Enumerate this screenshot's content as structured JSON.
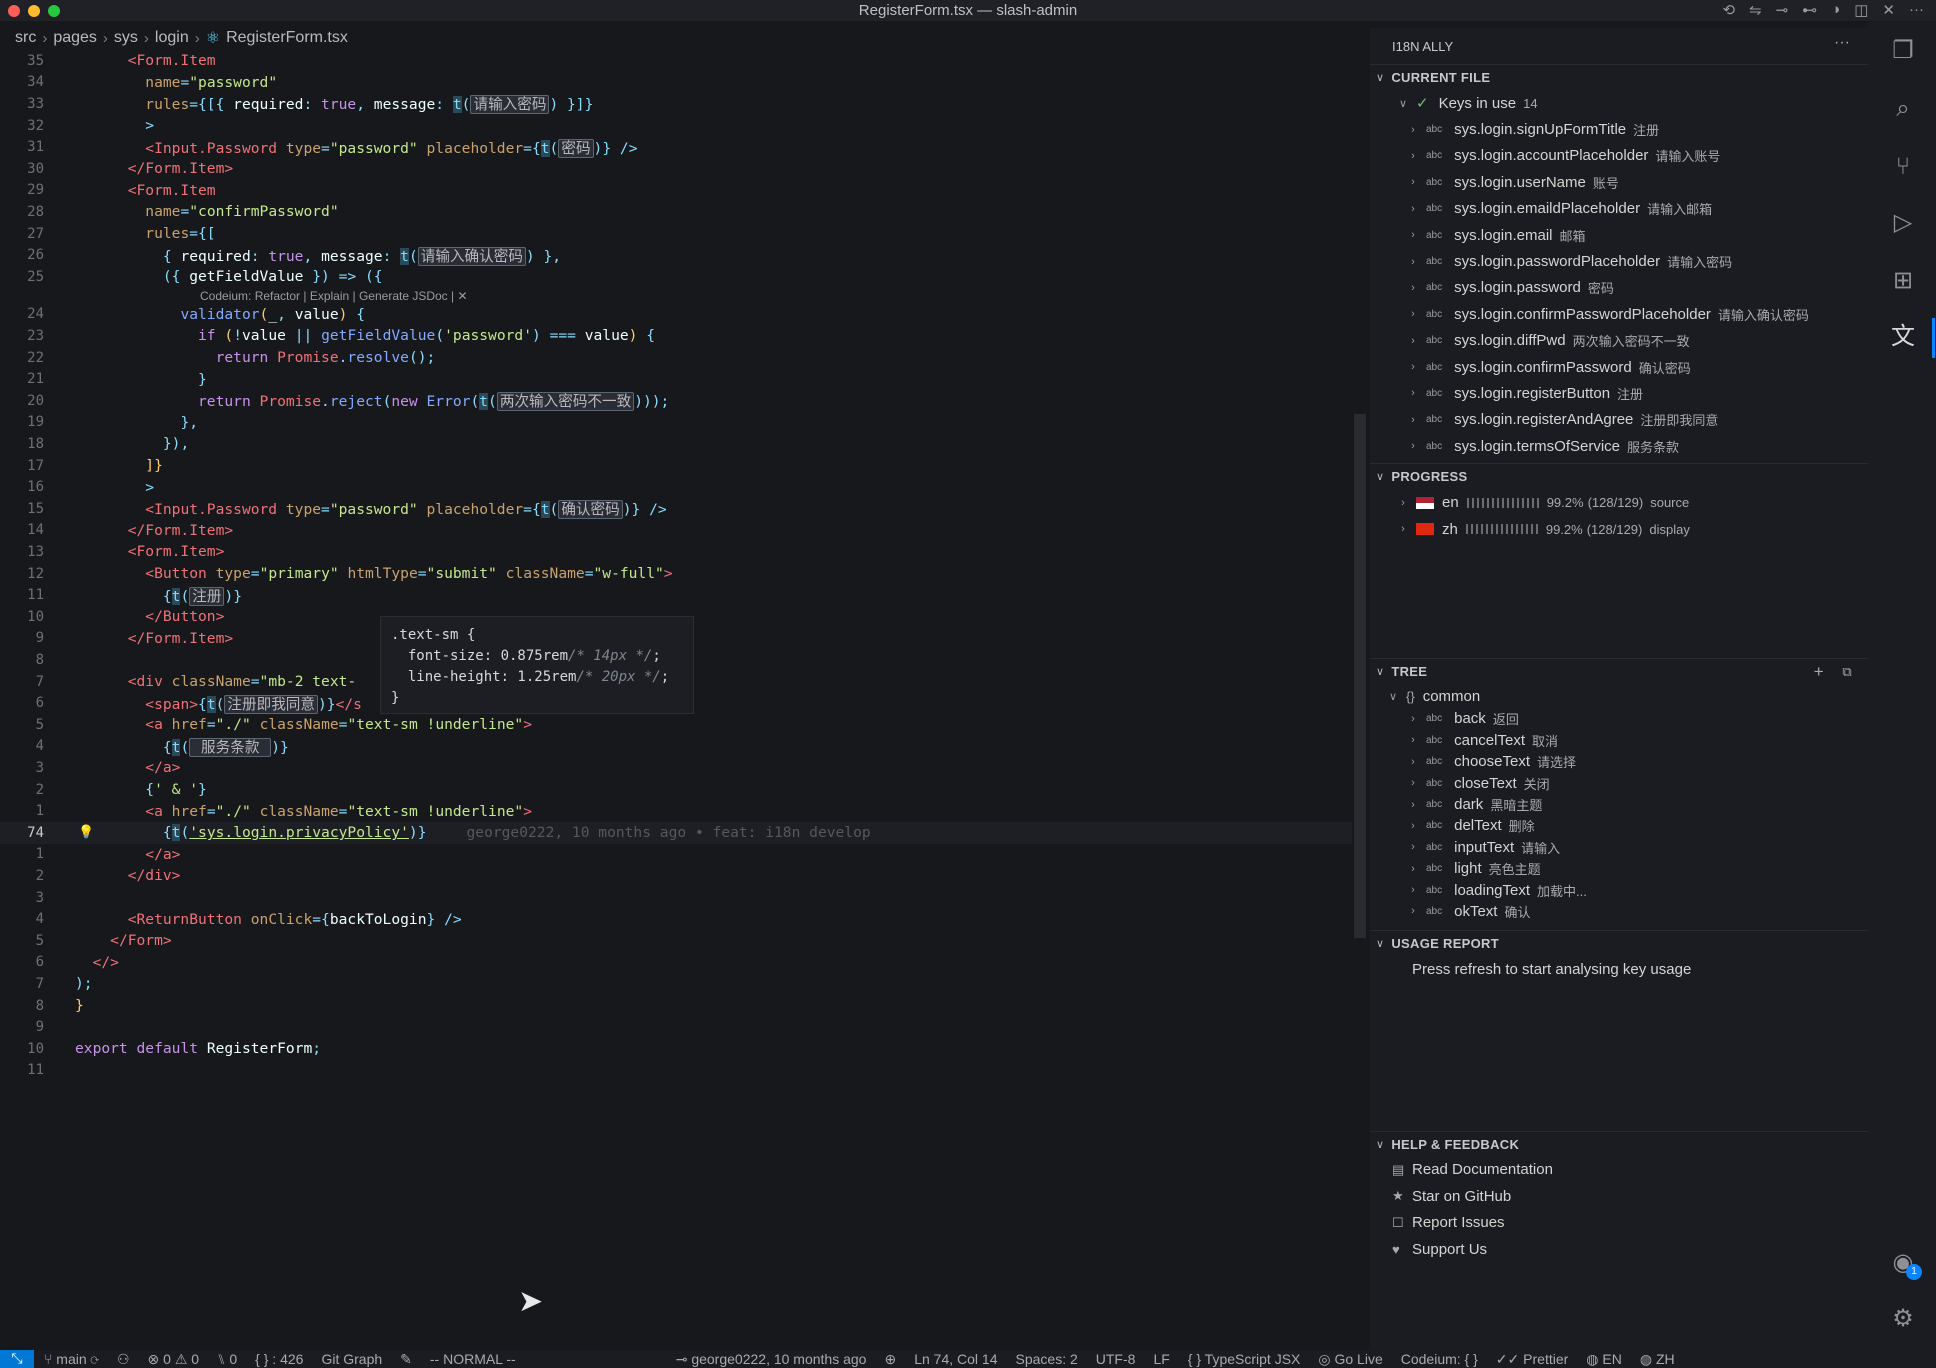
{
  "window": {
    "title": "RegisterForm.tsx — slash-admin"
  },
  "breadcrumb": [
    "src",
    "pages",
    "sys",
    "login",
    "RegisterForm.tsx"
  ],
  "editor": {
    "codelens": "Codeium: Refactor | Explain | Generate JSDoc | ✕",
    "blame": "george0222, 10 months ago • feat: i18n develop",
    "lines": [
      {
        "n": "35",
        "html": "      <span class='tg'>&lt;Form.Item</span>"
      },
      {
        "n": "34",
        "html": "        <span class='at'>name</span><span class='pu'>=</span><span class='st'>\"password\"</span>"
      },
      {
        "n": "33",
        "html": "        <span class='at'>rules</span><span class='pu'>={[{ </span><span class='id'>required</span><span class='pu'>: </span><span class='kw'>true</span><span class='pu'>, </span><span class='id'>message</span><span class='pu'>: </span><span class='tt'>t</span><span class='pu'>(</span><span class='tbox'>请输入密码</span><span class='pu'>) }]}</span>"
      },
      {
        "n": "32",
        "html": "        <span class='pu'>&gt;</span>"
      },
      {
        "n": "31",
        "html": "        <span class='tg'>&lt;Input.Password</span> <span class='at'>type</span><span class='pu'>=</span><span class='st'>\"password\"</span> <span class='at'>placeholder</span><span class='pu'>={</span><span class='tt'>t</span><span class='pu'>(</span><span class='tbox'>密码</span><span class='pu'>)} /&gt;</span>"
      },
      {
        "n": "30",
        "html": "      <span class='tg'>&lt;/Form.Item&gt;</span>"
      },
      {
        "n": "29",
        "html": "      <span class='tg'>&lt;Form.Item</span>"
      },
      {
        "n": "28",
        "html": "        <span class='at'>name</span><span class='pu'>=</span><span class='st'>\"confirmPassword\"</span>"
      },
      {
        "n": "27",
        "html": "        <span class='at'>rules</span><span class='pu'>={[</span>"
      },
      {
        "n": "26",
        "html": "          <span class='pu'>{ </span><span class='id'>required</span><span class='pu'>: </span><span class='kw'>true</span><span class='pu'>, </span><span class='id'>message</span><span class='pu'>: </span><span class='tt'>t</span><span class='pu'>(</span><span class='tbox'>请输入确认密码</span><span class='pu'>) },</span>"
      },
      {
        "n": "25",
        "html": "          <span class='pu'>({ </span><span class='id'>getFieldValue</span><span class='pu'> }) =&gt; ({</span>"
      },
      {
        "n": "",
        "html": ""
      },
      {
        "n": "24",
        "html": "            <span class='fn'>validator</span><span class='br'>(</span><span class='id'>_</span><span class='pu'>, </span><span class='id'>value</span><span class='br'>)</span> <span class='pu'>{</span>"
      },
      {
        "n": "23",
        "html": "              <span class='kw'>if</span> <span class='br'>(</span><span class='pu'>!</span><span class='id'>value</span> <span class='pu'>||</span> <span class='fn'>getFieldValue</span><span class='pu'>(</span><span class='st'>'password'</span><span class='pu'>) === </span><span class='id'>value</span><span class='br'>)</span> <span class='pu'>{</span>"
      },
      {
        "n": "22",
        "html": "                <span class='kw'>return</span> <span class='tg'>Promise</span><span class='pu'>.</span><span class='fn'>resolve</span><span class='pu'>();</span>"
      },
      {
        "n": "21",
        "html": "              <span class='pu'>}</span>"
      },
      {
        "n": "20",
        "html": "              <span class='kw'>return</span> <span class='tg'>Promise</span><span class='pu'>.</span><span class='fn'>reject</span><span class='pu'>(</span><span class='kw'>new</span> <span class='fn'>Error</span><span class='pu'>(</span><span class='tt'>t</span><span class='pu'>(</span><span class='tbox'>两次输入密码不一致</span><span class='pu'>)));</span>"
      },
      {
        "n": "19",
        "html": "            <span class='pu'>},</span>"
      },
      {
        "n": "18",
        "html": "          <span class='pu'>}),</span>"
      },
      {
        "n": "17",
        "html": "        <span class='br'>]}</span>"
      },
      {
        "n": "16",
        "html": "        <span class='pu'>&gt;</span>"
      },
      {
        "n": "15",
        "html": "        <span class='tg'>&lt;Input.Password</span> <span class='at'>type</span><span class='pu'>=</span><span class='st'>\"password\"</span> <span class='at'>placeholder</span><span class='pu'>={</span><span class='tt'>t</span><span class='pu'>(</span><span class='tbox'>确认密码</span><span class='pu'>)} /&gt;</span>"
      },
      {
        "n": "14",
        "html": "      <span class='tg'>&lt;/Form.Item&gt;</span>"
      },
      {
        "n": "13",
        "html": "      <span class='tg'>&lt;Form.Item&gt;</span>"
      },
      {
        "n": "12",
        "html": "        <span class='tg'>&lt;Button</span> <span class='at'>type</span><span class='pu'>=</span><span class='st'>\"primary\"</span> <span class='at'>htmlType</span><span class='pu'>=</span><span class='st'>\"submit\"</span> <span class='at'>className</span><span class='pu'>=</span><span class='st'>\"w-full\"</span><span class='tg'>&gt;</span>"
      },
      {
        "n": "11",
        "html": "          <span class='pu'>{</span><span class='tt'>t</span><span class='pu'>(</span><span class='tbox'>注册</span><span class='pu'>)}</span>"
      },
      {
        "n": "10",
        "html": "        <span class='tg'>&lt;/Button&gt;</span>"
      },
      {
        "n": "9",
        "html": "      <span class='tg'>&lt;/Form.Item&gt;</span>"
      },
      {
        "n": "8",
        "html": ""
      },
      {
        "n": "7",
        "html": "      <span class='tg'>&lt;div</span> <span class='at'>className</span><span class='pu'>=</span><span class='st'>\"mb-2 text-</span>"
      },
      {
        "n": "6",
        "html": "        <span class='tg'>&lt;span&gt;</span><span class='pu'>{</span><span class='tt'>t</span><span class='pu'>(</span><span class='tbox'>注册即我同意</span><span class='pu'>)}</span><span class='tg'>&lt;/s</span>"
      },
      {
        "n": "5",
        "html": "        <span class='tg'>&lt;a</span> <span class='at'>href</span><span class='pu'>=</span><span class='st'>\"./\"</span> <span class='at'>className</span><span class='pu'>=</span><span class='st'>\"text-sm !underline\"</span><span class='tg'>&gt;</span>"
      },
      {
        "n": "4",
        "html": "          <span class='pu'>{</span><span class='tt'>t</span><span class='pu'>(</span><span class='tbox'> 服务条款 </span><span class='pu'>)}</span>"
      },
      {
        "n": "3",
        "html": "        <span class='tg'>&lt;/a&gt;</span>"
      },
      {
        "n": "2",
        "html": "        <span class='pu'>{</span><span class='st'>' &amp; '</span><span class='pu'>}</span>"
      },
      {
        "n": "1",
        "html": "        <span class='tg'>&lt;a</span> <span class='at'>href</span><span class='pu'>=</span><span class='st'>\"./\"</span> <span class='at'>className</span><span class='pu'>=</span><span class='st'>\"text-sm !underline\"</span><span class='tg'>&gt;</span>"
      },
      {
        "n": "74",
        "html": "          <span class='pu'>{</span><span class='tt'>t</span><span class='pu'>(</span><span class='st' style='text-decoration:underline'>'sys.login.privacyPolicy'</span><span class='pu'>)}</span>"
      },
      {
        "n": "1",
        "html": "        <span class='tg'>&lt;/a&gt;</span>"
      },
      {
        "n": "2",
        "html": "      <span class='tg'>&lt;/div&gt;</span>"
      },
      {
        "n": "3",
        "html": ""
      },
      {
        "n": "4",
        "html": "      <span class='tg'>&lt;ReturnButton</span> <span class='at'>onClick</span><span class='pu'>={</span><span class='id'>backToLogin</span><span class='pu'>} /&gt;</span>"
      },
      {
        "n": "5",
        "html": "    <span class='tg'>&lt;/Form&gt;</span>"
      },
      {
        "n": "6",
        "html": "  <span class='tg'>&lt;/&gt;</span>"
      },
      {
        "n": "7",
        "html": "<span class='pu'>);</span>"
      },
      {
        "n": "8",
        "html": "<span class='br'>}</span>"
      },
      {
        "n": "9",
        "html": ""
      },
      {
        "n": "10",
        "html": "<span class='kw'>export</span> <span class='kw'>default</span> <span class='id'>RegisterForm</span><span class='pu'>;</span>"
      },
      {
        "n": "11",
        "html": ""
      }
    ]
  },
  "hover": {
    "l1": ".text-sm {",
    "l2a": "  font-size: 0.875rem",
    "l2b": "/* 14px */",
    "l2c": ";",
    "l3a": "  line-height: 1.25rem",
    "l3b": "/* 20px */",
    "l3c": ";",
    "l4": "}"
  },
  "panel": {
    "title": "I18N ALLY",
    "more": "···",
    "current_file": {
      "header": "CURRENT FILE",
      "group_label": "Keys in use",
      "group_count": "14",
      "keys": [
        {
          "key": "sys.login.signUpFormTitle",
          "zh": "注册"
        },
        {
          "key": "sys.login.accountPlaceholder",
          "zh": "请输入账号"
        },
        {
          "key": "sys.login.userName",
          "zh": "账号"
        },
        {
          "key": "sys.login.emaildPlaceholder",
          "zh": "请输入邮箱"
        },
        {
          "key": "sys.login.email",
          "zh": "邮箱"
        },
        {
          "key": "sys.login.passwordPlaceholder",
          "zh": "请输入密码"
        },
        {
          "key": "sys.login.password",
          "zh": "密码"
        },
        {
          "key": "sys.login.confirmPasswordPlaceholder",
          "zh": "请输入确认密码"
        },
        {
          "key": "sys.login.diffPwd",
          "zh": "两次输入密码不一致"
        },
        {
          "key": "sys.login.confirmPassword",
          "zh": "确认密码"
        },
        {
          "key": "sys.login.registerButton",
          "zh": "注册"
        },
        {
          "key": "sys.login.registerAndAgree",
          "zh": "注册即我同意"
        },
        {
          "key": "sys.login.termsOfService",
          "zh": "服务条款"
        }
      ]
    },
    "progress": {
      "header": "PROGRESS",
      "items": [
        {
          "lang": "en",
          "pct": "99.2%",
          "frac": "(128/129)",
          "role": "source",
          "value": 0.992
        },
        {
          "lang": "zh",
          "pct": "99.2%",
          "frac": "(128/129)",
          "role": "display",
          "value": 0.992
        }
      ]
    },
    "tree": {
      "header": "TREE",
      "root": "common",
      "items": [
        {
          "key": "back",
          "zh": "返回"
        },
        {
          "key": "cancelText",
          "zh": "取消"
        },
        {
          "key": "chooseText",
          "zh": "请选择"
        },
        {
          "key": "closeText",
          "zh": "关闭"
        },
        {
          "key": "dark",
          "zh": "黑暗主题"
        },
        {
          "key": "delText",
          "zh": "删除"
        },
        {
          "key": "inputText",
          "zh": "请输入"
        },
        {
          "key": "light",
          "zh": "亮色主题"
        },
        {
          "key": "loadingText",
          "zh": "加载中..."
        },
        {
          "key": "okText",
          "zh": "确认"
        }
      ]
    },
    "usage": {
      "header": "USAGE REPORT",
      "message": "Press refresh to start analysing key usage"
    },
    "help": {
      "header": "HELP & FEEDBACK",
      "items": [
        "Read Documentation",
        "Star on GitHub",
        "Report Issues",
        "Support Us"
      ]
    }
  },
  "status": {
    "branch": "main",
    "errors": "0",
    "warnings": "0",
    "ports": "0",
    "braces": "{ } : 426",
    "gitgraph": "Git Graph",
    "mode": "-- NORMAL --",
    "blame": "george0222, 10 months ago",
    "position": "Ln 74, Col 14",
    "spaces": "Spaces: 2",
    "encoding": "UTF-8",
    "eol": "LF",
    "language": "TypeScript JSX",
    "golive": "Go Live",
    "codeium": "Codeium: { }",
    "prettier": "Prettier",
    "lang1": "EN",
    "lang2": "ZH"
  },
  "colors": {
    "accent": "#0078d4",
    "badge": "#0a84ff"
  }
}
